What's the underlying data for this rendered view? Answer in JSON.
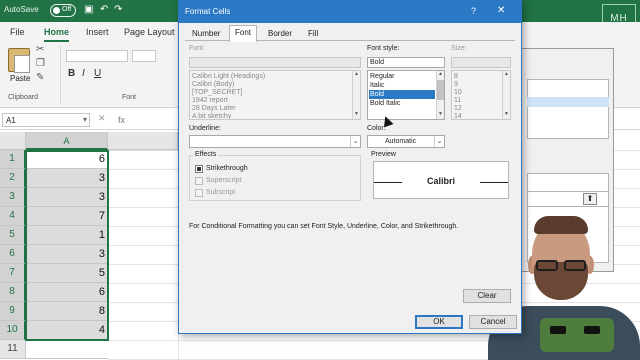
{
  "excel": {
    "autosave_label": "AutoSave",
    "autosave_state": "Off",
    "tabs": [
      "File",
      "Home",
      "Insert",
      "Page Layout"
    ],
    "active_tab": "Home",
    "ribbon": {
      "paste_label": "Paste",
      "clipboard_group": "Clipboard",
      "font_group": "Font"
    },
    "name_box": "A1",
    "fx_label": "fx",
    "column_a": "A",
    "rows": [
      {
        "n": "1",
        "v": "6"
      },
      {
        "n": "2",
        "v": "3"
      },
      {
        "n": "3",
        "v": "3"
      },
      {
        "n": "4",
        "v": "7"
      },
      {
        "n": "5",
        "v": "1"
      },
      {
        "n": "6",
        "v": "3"
      },
      {
        "n": "7",
        "v": "5"
      },
      {
        "n": "8",
        "v": "6"
      },
      {
        "n": "9",
        "v": "8"
      },
      {
        "n": "10",
        "v": "4"
      },
      {
        "n": "11",
        "v": ""
      }
    ]
  },
  "dialog": {
    "title": "Format Cells",
    "help": "?",
    "close": "✕",
    "tabs": [
      "Number",
      "Font",
      "Border",
      "Fill"
    ],
    "active_tab": "Font",
    "font_label": "Font:",
    "font_value": "",
    "font_list": [
      "Calibri Light (Headings)",
      "Calibri (Body)",
      "[TOP_SECRET]",
      "1942 report",
      "28 Days Later",
      "A bit sketchy"
    ],
    "style_label": "Font style:",
    "style_value": "Bold",
    "style_list": [
      "Regular",
      "Italic",
      "Bold",
      "Bold Italic"
    ],
    "style_selected": "Bold",
    "size_label": "Size:",
    "size_list": [
      "8",
      "9",
      "10",
      "11",
      "12",
      "14"
    ],
    "underline_label": "Underline:",
    "underline_value": "",
    "color_label": "Color:",
    "color_value": "Automatic",
    "effects_label": "Effects",
    "strikethrough_label": "Strikethrough",
    "superscript_label": "Superscript",
    "subscript_label": "Subscript",
    "preview_label": "Preview",
    "preview_text": "Calibri",
    "info_text": "For Conditional Formatting you can set Font Style, Underline, Color, and Strikethrough.",
    "clear_label": "Clear",
    "ok_label": "OK",
    "cancel_label": "Cancel"
  },
  "watermark": "MH",
  "colors": {
    "excel_green": "#217346",
    "dialog_blue": "#2b78c5",
    "selection_gray": "#dcdcdc"
  }
}
